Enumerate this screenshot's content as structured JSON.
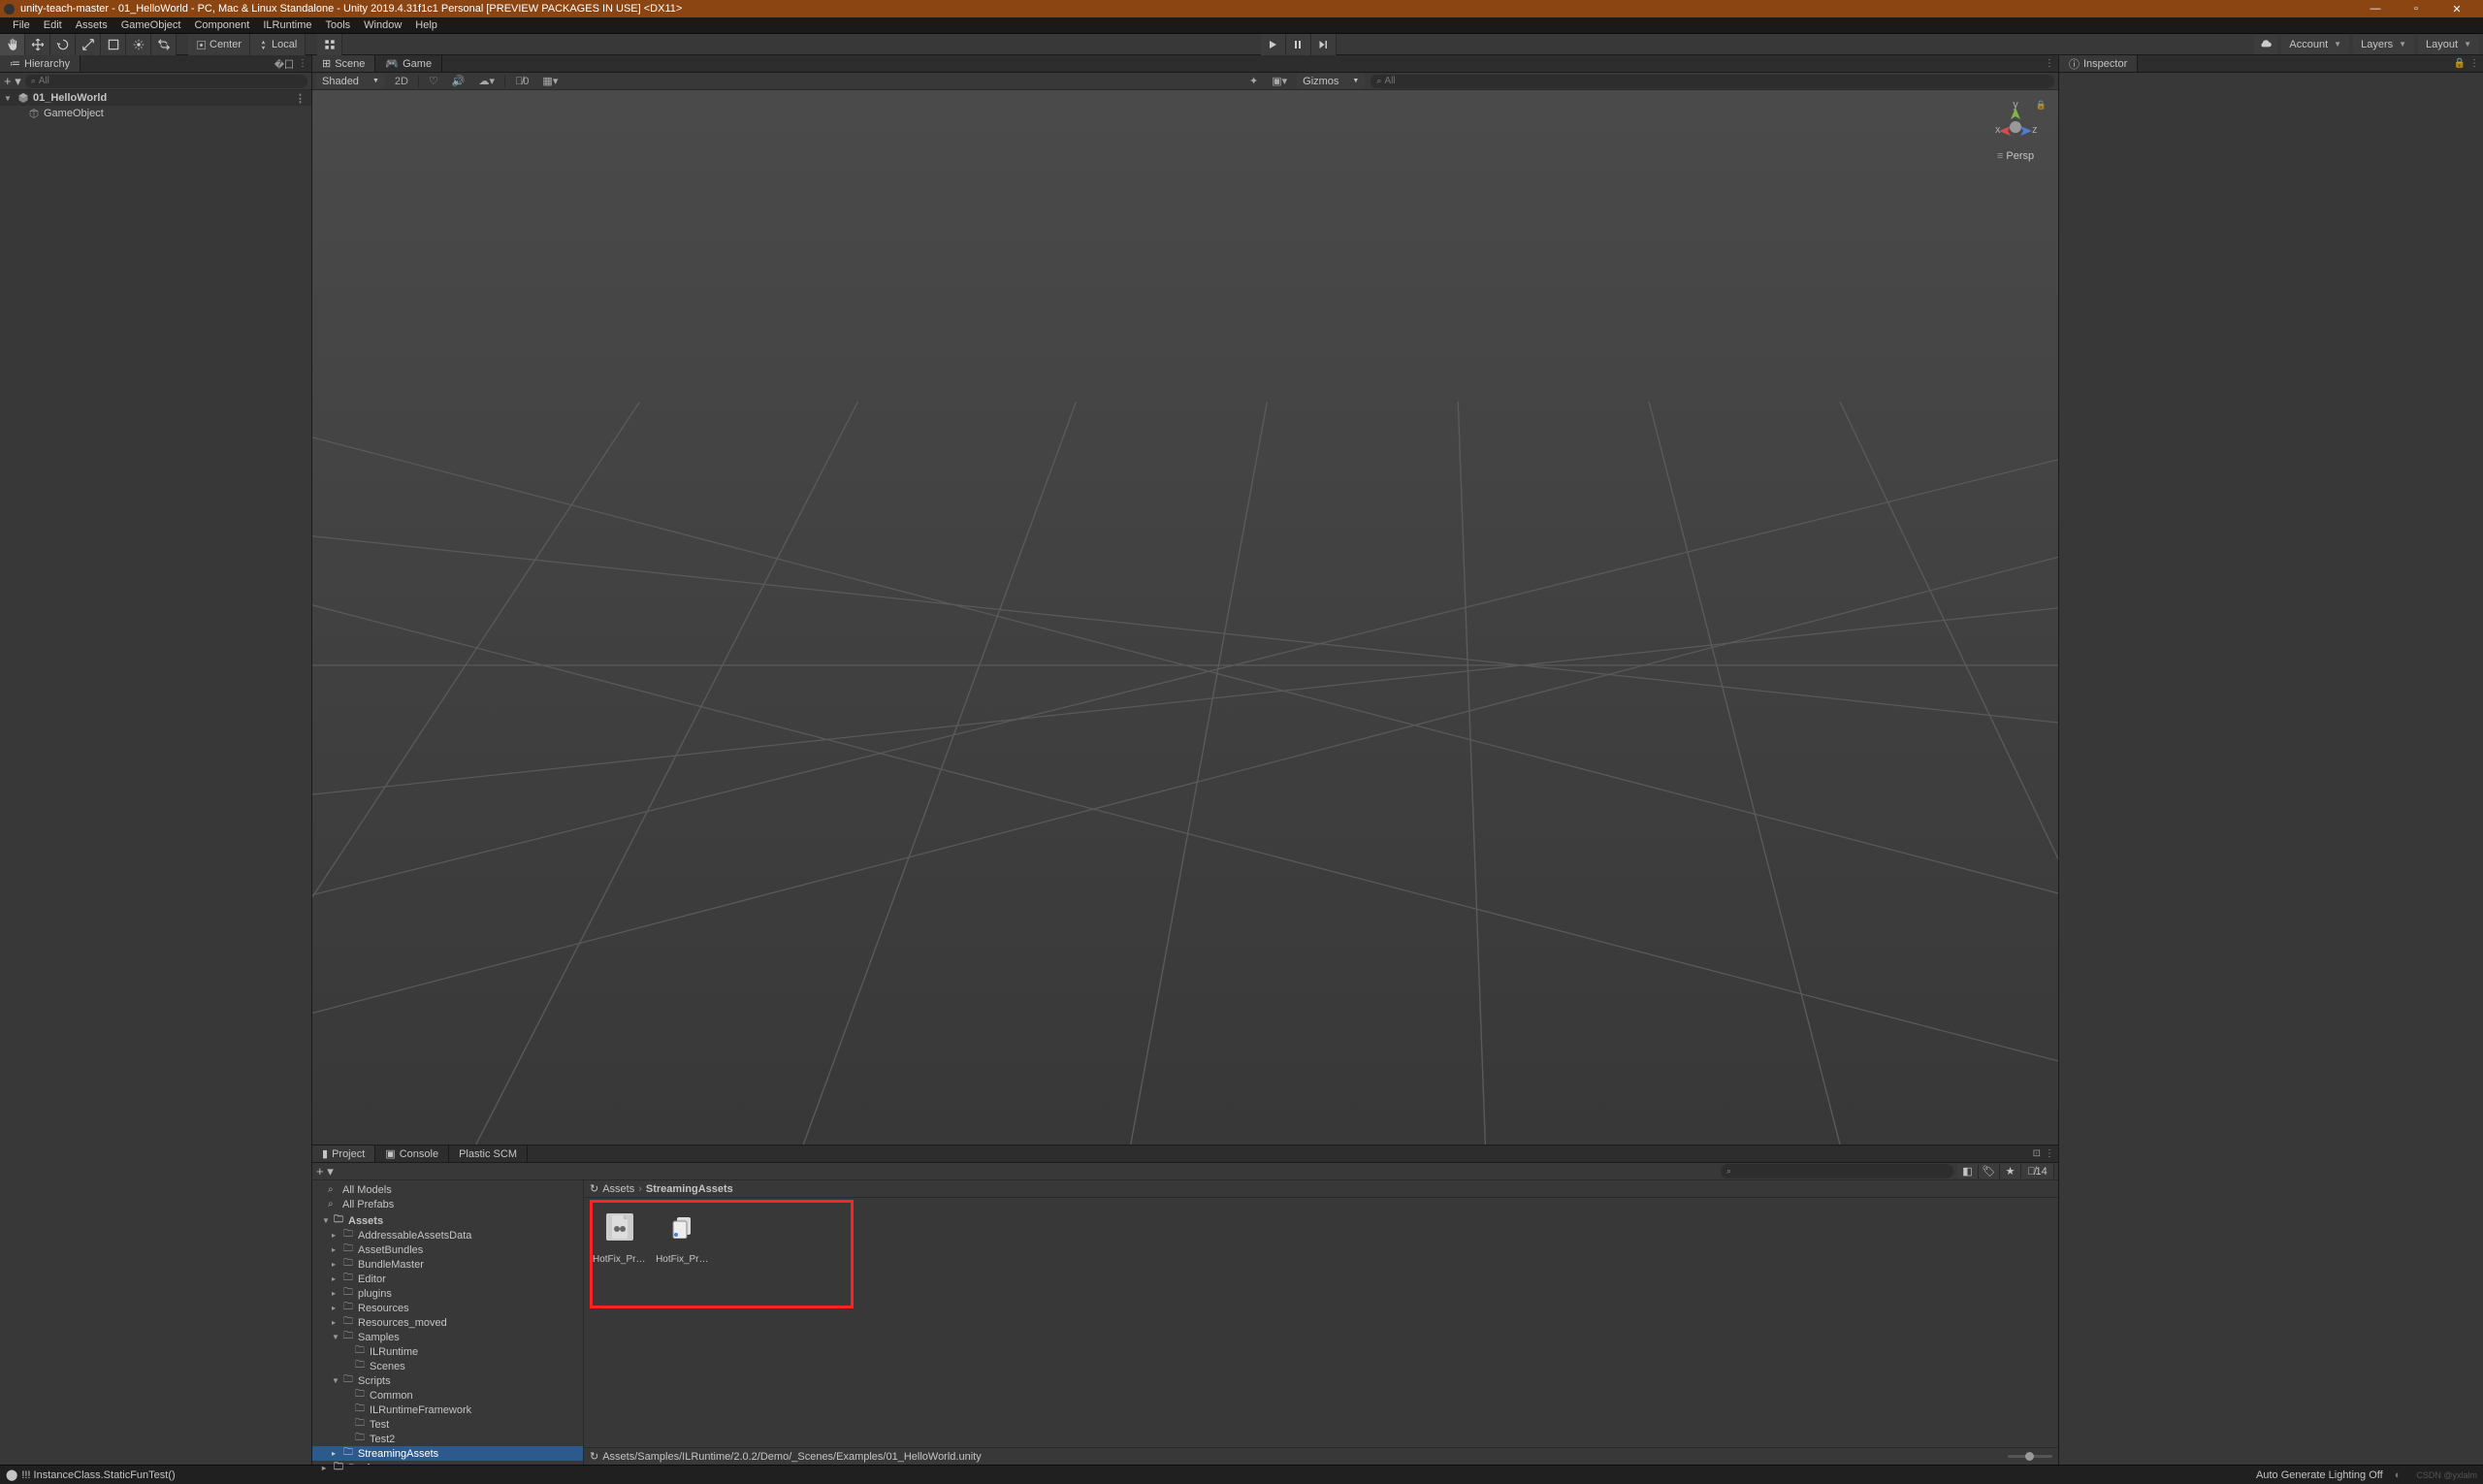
{
  "title": "unity-teach-master - 01_HelloWorld - PC, Mac & Linux Standalone - Unity 2019.4.31f1c1 Personal [PREVIEW PACKAGES IN USE] <DX11>",
  "menu": [
    "File",
    "Edit",
    "Assets",
    "GameObject",
    "Component",
    "ILRuntime",
    "Tools",
    "Window",
    "Help"
  ],
  "toolbar": {
    "center": "Center",
    "local": "Local"
  },
  "dropdowns": {
    "account": "Account",
    "layers": "Layers",
    "layout": "Layout"
  },
  "hierarchy": {
    "tab": "Hierarchy",
    "search_placeholder": "All",
    "scene": "01_HelloWorld",
    "items": [
      "GameObject"
    ]
  },
  "scene": {
    "tab_scene": "Scene",
    "tab_game": "Game",
    "shading": "Shaded",
    "twoD": "2D",
    "gizmos": "Gizmos",
    "search_placeholder": "All",
    "axis_x": "x",
    "axis_y": "y",
    "axis_z": "z",
    "persp": "Persp",
    "occ": "0"
  },
  "inspector": {
    "tab": "Inspector"
  },
  "project": {
    "tab_project": "Project",
    "tab_console": "Console",
    "tab_plastic": "Plastic SCM",
    "favorites": [
      "All Models",
      "All Prefabs"
    ],
    "tree": [
      {
        "label": "Assets",
        "depth": 1,
        "bold": true,
        "open": true
      },
      {
        "label": "AddressableAssetsData",
        "depth": 2
      },
      {
        "label": "AssetBundles",
        "depth": 2
      },
      {
        "label": "BundleMaster",
        "depth": 2
      },
      {
        "label": "Editor",
        "depth": 2
      },
      {
        "label": "plugins",
        "depth": 2
      },
      {
        "label": "Resources",
        "depth": 2
      },
      {
        "label": "Resources_moved",
        "depth": 2
      },
      {
        "label": "Samples",
        "depth": 2,
        "open": true
      },
      {
        "label": "ILRuntime",
        "depth": 3
      },
      {
        "label": "Scenes",
        "depth": 3
      },
      {
        "label": "Scripts",
        "depth": 2,
        "open": true
      },
      {
        "label": "Common",
        "depth": 3
      },
      {
        "label": "ILRuntimeFramework",
        "depth": 3
      },
      {
        "label": "Test",
        "depth": 3
      },
      {
        "label": "Test2",
        "depth": 3
      },
      {
        "label": "StreamingAssets",
        "depth": 2,
        "sel": true
      },
      {
        "label": "Packages",
        "depth": 1,
        "bold": true
      }
    ],
    "breadcrumb": [
      "Assets",
      "StreamingAssets"
    ],
    "assets": [
      {
        "label": "HotFix_Pro..."
      },
      {
        "label": "HotFix_Pro..."
      }
    ],
    "footer_path": "Assets/Samples/ILRuntime/2.0.2/Demo/_Scenes/Examples/01_HelloWorld.unity",
    "hidden_count": "14"
  },
  "status": {
    "msg": "!!! InstanceClass.StaticFunTest()",
    "lighting": "Auto Generate Lighting Off"
  },
  "watermark": "CSDN @yxlalm"
}
